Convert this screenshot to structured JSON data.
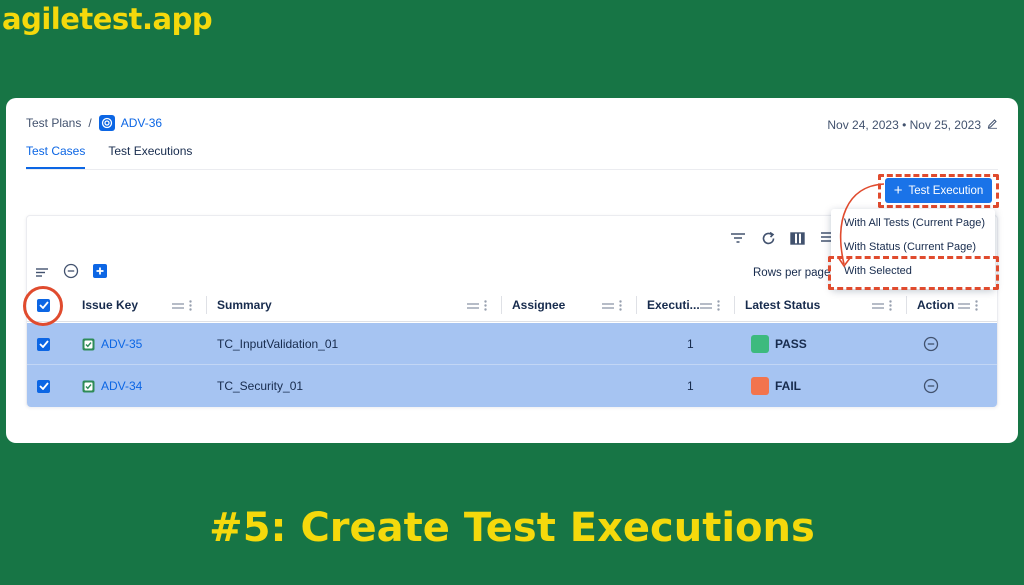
{
  "brand": "agiletest.app",
  "headline": "#5: Create Test Executions",
  "breadcrumb": {
    "root": "Test Plans",
    "separator": "/",
    "issue": "ADV-36"
  },
  "dates": "Nov 24, 2023 • Nov 25, 2023",
  "tabs": [
    {
      "label": "Test Cases",
      "active": true
    },
    {
      "label": "Test Executions",
      "active": false
    }
  ],
  "toolbar": {
    "rows_per_page_label": "Rows per page:"
  },
  "test_execution_button": {
    "label": "Test Execution"
  },
  "dropdown": {
    "items": [
      "With All Tests (Current Page)",
      "With Status (Current Page)",
      "With Selected"
    ]
  },
  "table": {
    "columns": [
      "Issue Key",
      "Summary",
      "Assignee",
      "Executi...",
      "Latest Status",
      "Action"
    ],
    "rows": [
      {
        "issue_key": "ADV-35",
        "summary": "TC_InputValidation_01",
        "assignee": "",
        "executions": "1",
        "status": "PASS",
        "status_color": "#3dba7e",
        "checked": true
      },
      {
        "issue_key": "ADV-34",
        "summary": "TC_Security_01",
        "assignee": "",
        "executions": "1",
        "status": "FAIL",
        "status_color": "#f2744d",
        "checked": true
      }
    ]
  },
  "colors": {
    "background": "#177545",
    "brand_yellow": "#f5d90c",
    "accent_blue": "#0c66e4",
    "annotation_red": "#e04b2e",
    "selected_row": "#a6c4f2"
  }
}
